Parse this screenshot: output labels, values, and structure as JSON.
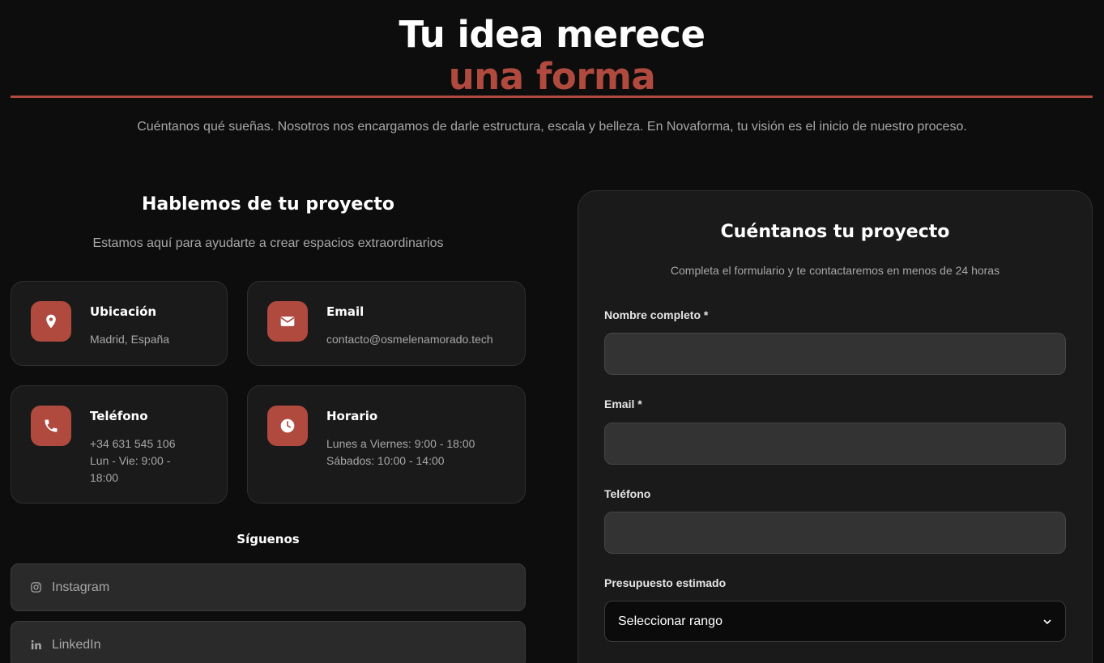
{
  "hero": {
    "title_line1": "Tu idea merece",
    "title_line2": "una forma",
    "subtitle": "Cuéntanos qué sueñas. Nosotros nos encargamos de darle estructura, escala y belleza. En Novaforma, tu visión es el inicio de nuestro proceso."
  },
  "contact": {
    "title": "Hablemos de tu proyecto",
    "subtitle": "Estamos aquí para ayudarte a crear espacios extraordinarios",
    "cards": [
      {
        "icon": "location-pin-icon",
        "title": "Ubicación",
        "lines": [
          "Madrid, España"
        ]
      },
      {
        "icon": "envelope-icon",
        "title": "Email",
        "lines": [
          "contacto@osmelenamorado.tech"
        ]
      },
      {
        "icon": "phone-icon",
        "title": "Teléfono",
        "lines": [
          "+34 631 545 106",
          "Lun - Vie: 9:00 -",
          "18:00"
        ]
      },
      {
        "icon": "clock-icon",
        "title": "Horario",
        "lines": [
          "Lunes a Viernes: 9:00 - 18:00",
          "Sábados: 10:00 - 14:00"
        ]
      }
    ],
    "follow_title": "Síguenos",
    "socials": [
      {
        "icon": "instagram-icon",
        "label": "Instagram"
      },
      {
        "icon": "linkedin-icon",
        "label": "LinkedIn"
      }
    ]
  },
  "form": {
    "title": "Cuéntanos tu proyecto",
    "subtitle": "Completa el formulario y te contactaremos en menos de 24 horas",
    "fields": [
      {
        "label": "Nombre completo *",
        "value": ""
      },
      {
        "label": "Email *",
        "value": ""
      },
      {
        "label": "Teléfono",
        "value": ""
      }
    ],
    "budget": {
      "label": "Presupuesto estimado",
      "selected": "Seleccionar rango"
    }
  },
  "colors": {
    "accent": "#b04a3f",
    "background": "#0d0d0d",
    "card": "#1a1a1a",
    "input": "#333333"
  }
}
